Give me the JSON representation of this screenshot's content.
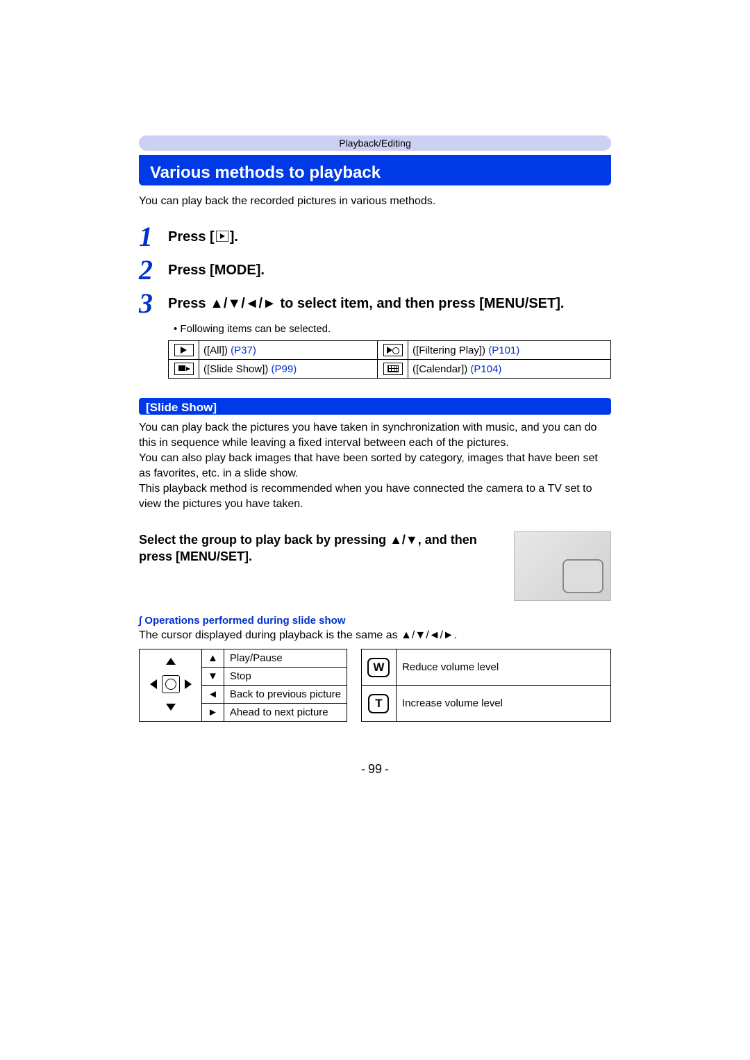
{
  "breadcrumb": "Playback/Editing",
  "title": "Various methods to playback",
  "intro": "You can play back the recorded pictures in various methods.",
  "steps": [
    {
      "num": "1",
      "text_prefix": "Press [",
      "icon": "play-icon",
      "text_suffix": "]."
    },
    {
      "num": "2",
      "text_prefix": "Press [MODE].",
      "icon": "",
      "text_suffix": ""
    },
    {
      "num": "3",
      "text_prefix": "Press ",
      "dirs": "▲/▼/◄/►",
      "text_mid": " to select item, and then press [MENU/SET].",
      "note": "Following items can be selected.",
      "options": [
        {
          "icon": "play",
          "label": "([All])",
          "ref": "(P37)"
        },
        {
          "icon": "filter",
          "label": "([Filtering Play])",
          "ref": "(P101)"
        },
        {
          "icon": "slide",
          "label": "([Slide Show])",
          "ref": "(P99)"
        },
        {
          "icon": "cal",
          "label": "([Calendar])",
          "ref": "(P104)"
        }
      ]
    }
  ],
  "section": {
    "heading": "[Slide Show]",
    "body1": "You can play back the pictures you have taken in synchronization with music, and you can do this in sequence while leaving a fixed interval between each of the pictures.",
    "body2": "You can also play back images that have been sorted by category, images that have been set as favorites, etc. in a slide show.",
    "body3": "This playback method is recommended when you have connected the camera to a TV set to view the pictures you have taken.",
    "substep": "Select the group to play back by pressing ▲/▼, and then press [MENU/SET]."
  },
  "ops": {
    "heading": "∫ Operations performed during slide show",
    "note_prefix": "The cursor displayed during playback is the same as ",
    "note_dirs": "▲/▼/◄/►",
    "note_suffix": ".",
    "left": [
      {
        "dir": "▲",
        "label": "Play/Pause"
      },
      {
        "dir": "▼",
        "label": "Stop"
      },
      {
        "dir": "◄",
        "label": "Back to previous picture"
      },
      {
        "dir": "►",
        "label": "Ahead to next picture"
      }
    ],
    "right": [
      {
        "btn": "W",
        "label": "Reduce volume level"
      },
      {
        "btn": "T",
        "label": "Increase volume level"
      }
    ]
  },
  "page_number": "99"
}
